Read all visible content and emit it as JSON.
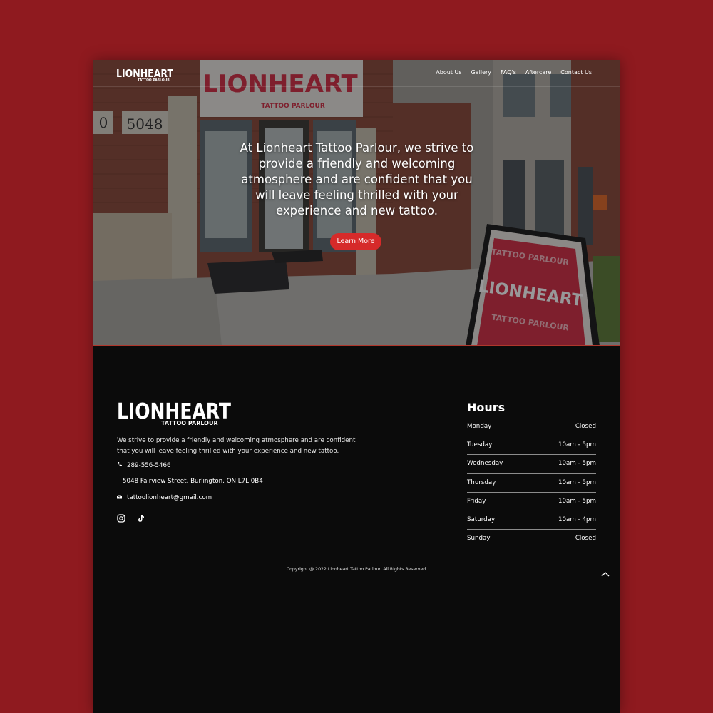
{
  "brand": {
    "name": "LIONHEART",
    "sub": "TATTOO PARLOUR"
  },
  "nav": {
    "items": [
      {
        "label": "About Us"
      },
      {
        "label": "Gallery"
      },
      {
        "label": "FAQ's"
      },
      {
        "label": "Aftercare"
      },
      {
        "label": "Contact Us"
      }
    ]
  },
  "storefront": {
    "address_number": "5048",
    "partial_number": "0",
    "sign_text": "TATTOO PARLOUR"
  },
  "hero": {
    "text": "At Lionheart Tattoo Parlour, we strive to provide a friendly and welcoming atmosphere and are confident that you will leave feeling thrilled with your experience and new tattoo.",
    "button_label": "Learn More"
  },
  "footer": {
    "description": "We strive to provide a friendly and welcoming atmosphere and are confident that you will leave feeling thrilled with your experience and new tattoo.",
    "phone": "289-556-5466",
    "address": "5048 Fairview Street, Burlington, ON L7L 0B4",
    "email": "tattoolionheart@gmail.com",
    "socials": [
      {
        "icon": "instagram-icon"
      },
      {
        "icon": "tiktok-icon"
      }
    ],
    "copyright": "Copyright @ 2022 Lionheart Tattoo Parlour. All Rights Reserved."
  },
  "hours": {
    "title": "Hours",
    "rows": [
      {
        "day": "Monday",
        "time": "Closed"
      },
      {
        "day": "Tuesday",
        "time": "10am - 5pm"
      },
      {
        "day": "Wednesday",
        "time": "10am - 5pm"
      },
      {
        "day": "Thursday",
        "time": "10am - 5pm"
      },
      {
        "day": "Friday",
        "time": "10am - 5pm"
      },
      {
        "day": "Saturday",
        "time": "10am - 4pm"
      },
      {
        "day": "Sunday",
        "time": "Closed"
      }
    ]
  },
  "colors": {
    "background": "#8f1a1f",
    "accent": "#d62a2a",
    "footer": "#0b0b0b"
  }
}
